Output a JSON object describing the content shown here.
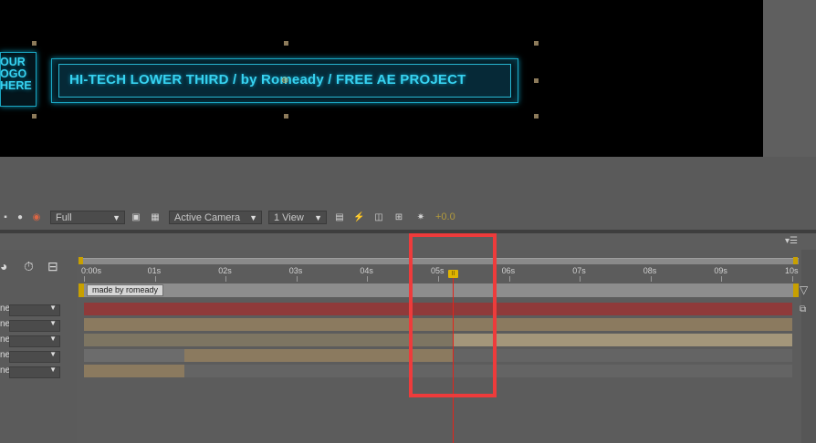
{
  "viewer": {
    "lower_third_text": "HI-TECH LOWER THIRD / by Romeady / FREE AE PROJECT",
    "logo_lines": [
      "OUR",
      "OGO",
      "HERE"
    ]
  },
  "viewer_toolbar": {
    "resolution": "Full",
    "view": "Active Camera",
    "layout": "1 View",
    "exposure": "+0.0"
  },
  "timeline": {
    "ruler_labels": [
      "0:00s",
      "01s",
      "02s",
      "03s",
      "04s",
      "05s",
      "06s",
      "07s",
      "08s",
      "09s",
      "10s"
    ],
    "marker_label": "made by romeady",
    "current_time_fraction": 0.5,
    "layers": [
      {
        "name_fragment": "ne"
      },
      {
        "name_fragment": "ne"
      },
      {
        "name_fragment": "ne"
      },
      {
        "name_fragment": "ne"
      },
      {
        "name_fragment": "ne"
      }
    ],
    "colors": {
      "red_layer": "#8f3a3a",
      "tan_layer": "#8b7a5f",
      "playhead": "#e2241c",
      "highlight": "#ee3b3b"
    }
  }
}
